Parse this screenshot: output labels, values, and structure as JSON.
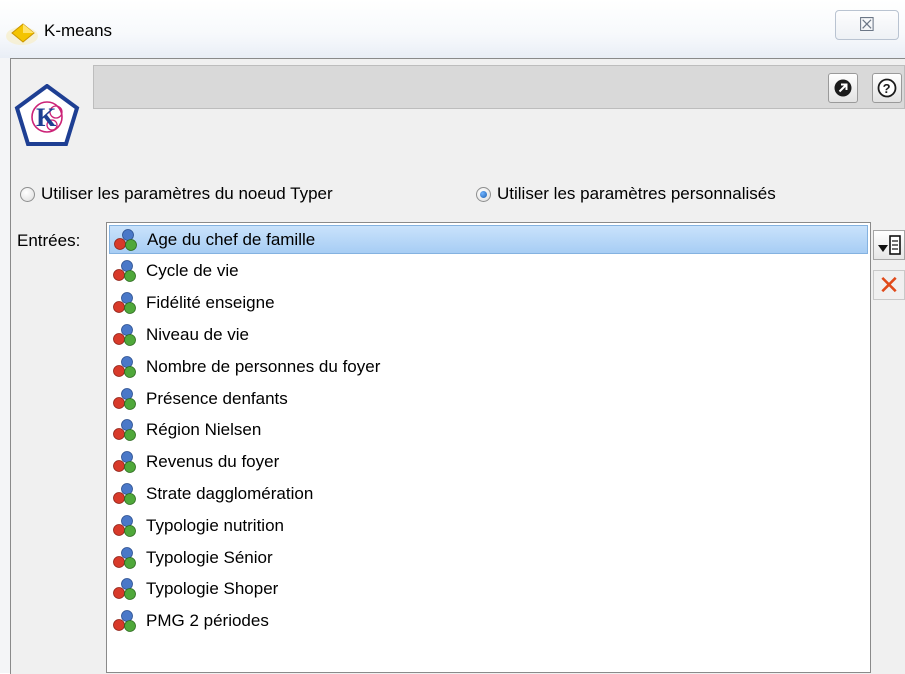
{
  "window": {
    "title": "K-means",
    "close_glyph": "☒",
    "icons": {
      "app": "diamond-icon",
      "close": "close-icon"
    }
  },
  "node": {
    "icon": "kmeans-node-icon",
    "icon_letter": "K"
  },
  "header": {
    "buttons": [
      {
        "name": "open-icon"
      },
      {
        "name": "help-icon",
        "glyph": "?"
      }
    ]
  },
  "radio_options": [
    {
      "label": "Utiliser les paramètres du noeud Typer",
      "checked": false
    },
    {
      "label": "Utiliser les paramètres personnalisés",
      "checked": true
    }
  ],
  "fields_label": "Entrées:",
  "fields": [
    {
      "label": "Age du chef de famille",
      "selected": true
    },
    {
      "label": "Cycle de vie"
    },
    {
      "label": "Fidélité enseigne"
    },
    {
      "label": "Niveau de vie"
    },
    {
      "label": "Nombre de personnes du foyer"
    },
    {
      "label": "Présence denfants"
    },
    {
      "label": "Région Nielsen"
    },
    {
      "label": "Revenus du foyer"
    },
    {
      "label": "Strate dagglomération"
    },
    {
      "label": "Typologie nutrition"
    },
    {
      "label": "Typologie Sénior"
    },
    {
      "label": "Typologie Shoper"
    },
    {
      "label": "PMG 2 périodes"
    }
  ],
  "side_buttons": [
    {
      "name": "field-picker-icon"
    },
    {
      "name": "delete-icon",
      "glyph": "✕"
    }
  ],
  "colors": {
    "selection": "#a7cdf4",
    "delete": "#e04a1a",
    "node_ring": "#1e3f93",
    "node_accent": "#cc2277"
  }
}
